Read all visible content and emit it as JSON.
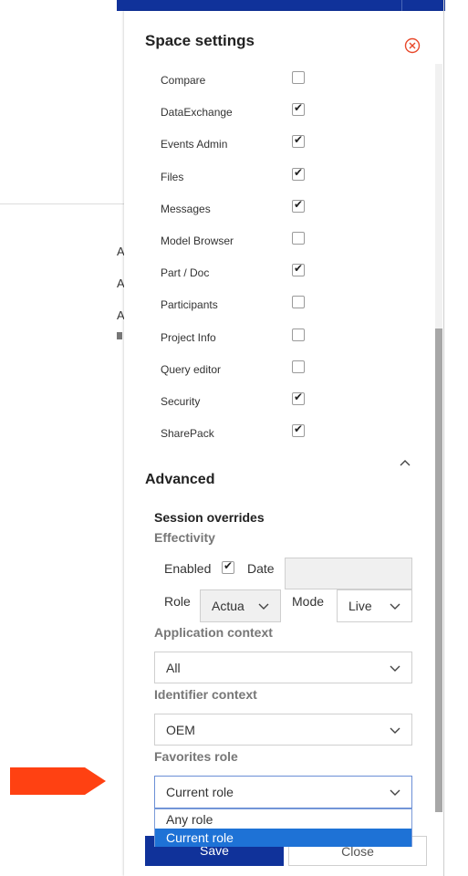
{
  "background": {
    "letters": [
      "A",
      "A",
      "A"
    ]
  },
  "panel": {
    "title": "Space settings",
    "close_icon": "close-circle-icon",
    "apps": [
      {
        "label": "Compare",
        "checked": false
      },
      {
        "label": "DataExchange",
        "checked": true
      },
      {
        "label": "Events Admin",
        "checked": true
      },
      {
        "label": "Files",
        "checked": true
      },
      {
        "label": "Messages",
        "checked": true
      },
      {
        "label": "Model Browser",
        "checked": false
      },
      {
        "label": "Part / Doc",
        "checked": true
      },
      {
        "label": "Participants",
        "checked": false
      },
      {
        "label": "Project Info",
        "checked": false
      },
      {
        "label": "Query editor",
        "checked": false
      },
      {
        "label": "Security",
        "checked": true
      },
      {
        "label": "SharePack",
        "checked": true
      }
    ],
    "advanced": {
      "title": "Advanced",
      "session_overrides": "Session overrides",
      "effectivity": {
        "heading": "Effectivity",
        "enabled_label": "Enabled",
        "enabled_checked": true,
        "date_label": "Date",
        "date_value": "",
        "role_label": "Role",
        "role_value": "Actua",
        "mode_label": "Mode",
        "mode_value": "Live"
      },
      "application_context": {
        "heading": "Application context",
        "value": "All"
      },
      "identifier_context": {
        "heading": "Identifier context",
        "value": "OEM"
      },
      "favorites_role": {
        "heading": "Favorites role",
        "value": "Current role",
        "options": [
          "Any role",
          "Current role"
        ],
        "selected": "Current role"
      }
    },
    "buttons": {
      "save": "Save",
      "close": "Close"
    }
  },
  "colors": {
    "primary": "#10329a",
    "highlight": "#1e72d6",
    "arrow": "#ff4112",
    "close_icon": "#e8492b"
  }
}
